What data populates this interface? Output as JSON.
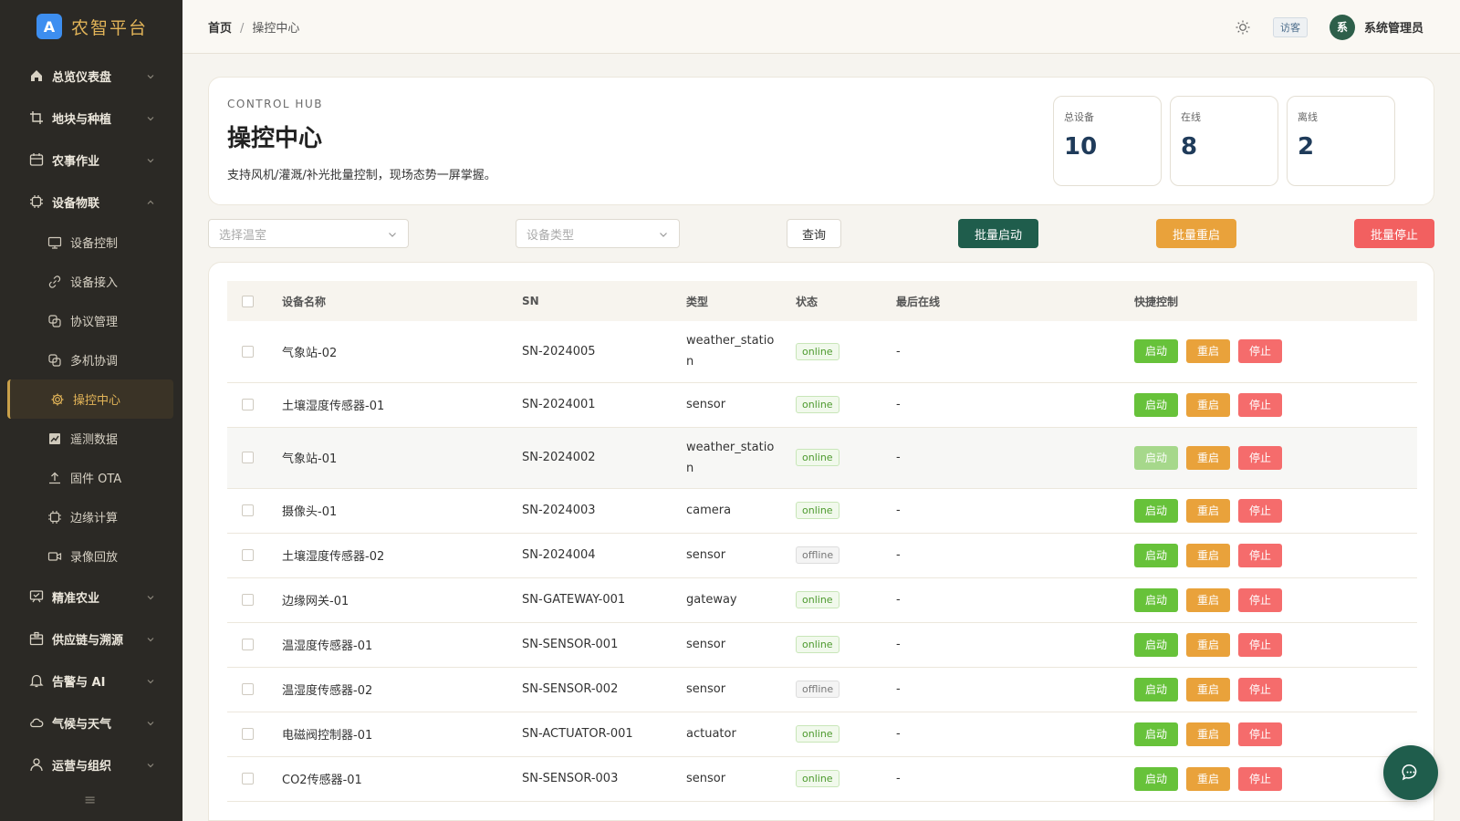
{
  "brand": {
    "logo": "A",
    "name": "农智平台"
  },
  "sidebar": {
    "groups_top": [
      {
        "label": "总览仪表盘",
        "icon": "home-icon"
      },
      {
        "label": "地块与种植",
        "icon": "crop-icon"
      },
      {
        "label": "农事作业",
        "icon": "calendar-icon"
      },
      {
        "label": "设备物联",
        "icon": "chip-icon"
      }
    ],
    "subitems": [
      {
        "label": "设备控制",
        "icon": "monitor-icon"
      },
      {
        "label": "设备接入",
        "icon": "link-icon"
      },
      {
        "label": "协议管理",
        "icon": "layers-icon"
      },
      {
        "label": "多机协调",
        "icon": "layers-icon"
      },
      {
        "label": "操控中心",
        "icon": "gear-icon"
      },
      {
        "label": "遥测数据",
        "icon": "chart-icon"
      },
      {
        "label": "固件 OTA",
        "icon": "upload-icon"
      },
      {
        "label": "边缘计算",
        "icon": "chip-icon"
      },
      {
        "label": "录像回放",
        "icon": "video-icon"
      }
    ],
    "groups_bottom": [
      {
        "label": "精准农业",
        "icon": "screen-icon"
      },
      {
        "label": "供应链与溯源",
        "icon": "box-icon"
      },
      {
        "label": "告警与 AI",
        "icon": "bell-icon"
      },
      {
        "label": "气候与天气",
        "icon": "cloud-icon"
      },
      {
        "label": "运营与组织",
        "icon": "user-icon"
      }
    ]
  },
  "header": {
    "breadcrumb_home": "首页",
    "breadcrumb_sep": "/",
    "breadcrumb_current": "操控中心",
    "guest_label": "访客",
    "avatar_text": "系",
    "user_name": "系统管理员"
  },
  "hero": {
    "kicker": "CONTROL HUB",
    "title": "操控中心",
    "desc": "支持风机/灌溉/补光批量控制，现场态势一屏掌握。",
    "stats": [
      {
        "label": "总设备",
        "value": "10"
      },
      {
        "label": "在线",
        "value": "8"
      },
      {
        "label": "离线",
        "value": "2"
      }
    ]
  },
  "toolbar": {
    "greenhouse_placeholder": "选择温室",
    "type_placeholder": "设备类型",
    "query": "查询",
    "batch_start": "批量启动",
    "batch_restart": "批量重启",
    "batch_stop": "批量停止"
  },
  "table": {
    "columns": {
      "name": "设备名称",
      "sn": "SN",
      "type": "类型",
      "status": "状态",
      "last": "最后在线",
      "ctrl": "快捷控制"
    },
    "actions": {
      "start": "启动",
      "restart": "重启",
      "stop": "停止"
    },
    "rows": [
      {
        "name": "气象站-02",
        "sn": "SN-2024005",
        "type": "weather_station",
        "status": "online",
        "last": "-"
      },
      {
        "name": "土壤湿度传感器-01",
        "sn": "SN-2024001",
        "type": "sensor",
        "status": "online",
        "last": "-"
      },
      {
        "name": "气象站-01",
        "sn": "SN-2024002",
        "type": "weather_station",
        "status": "online",
        "last": "-"
      },
      {
        "name": "摄像头-01",
        "sn": "SN-2024003",
        "type": "camera",
        "status": "online",
        "last": "-"
      },
      {
        "name": "土壤湿度传感器-02",
        "sn": "SN-2024004",
        "type": "sensor",
        "status": "offline",
        "last": "-"
      },
      {
        "name": "边缘网关-01",
        "sn": "SN-GATEWAY-001",
        "type": "gateway",
        "status": "online",
        "last": "-"
      },
      {
        "name": "温湿度传感器-01",
        "sn": "SN-SENSOR-001",
        "type": "sensor",
        "status": "online",
        "last": "-"
      },
      {
        "name": "温湿度传感器-02",
        "sn": "SN-SENSOR-002",
        "type": "sensor",
        "status": "offline",
        "last": "-"
      },
      {
        "name": "电磁阀控制器-01",
        "sn": "SN-ACTUATOR-001",
        "type": "actuator",
        "status": "online",
        "last": "-"
      },
      {
        "name": "CO2传感器-01",
        "sn": "SN-SENSOR-003",
        "type": "sensor",
        "status": "online",
        "last": "-"
      }
    ]
  },
  "colors": {
    "sidebar_bg": "#2b2925",
    "accent_gold": "#e2b458",
    "primary_green": "#1f5d4c",
    "warn_orange": "#e9a23b",
    "danger_red": "#f26060",
    "success_green": "#67c23a"
  }
}
